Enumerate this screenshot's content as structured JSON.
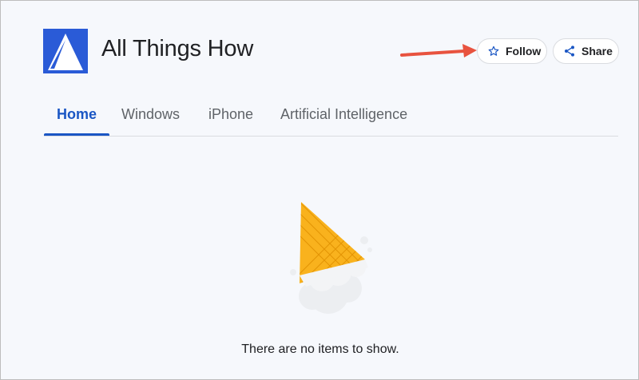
{
  "header": {
    "site_title": "All Things How",
    "follow_label": "Follow",
    "share_label": "Share"
  },
  "tabs": [
    {
      "label": "Home",
      "active": true
    },
    {
      "label": "Windows",
      "active": false
    },
    {
      "label": "iPhone",
      "active": false
    },
    {
      "label": "Artificial Intelligence",
      "active": false
    }
  ],
  "empty_state": {
    "message": "There are no items to show.",
    "illustration": "ice-cream-cone"
  },
  "annotation": {
    "arrow_color": "#e8533f"
  },
  "colors": {
    "accent": "#1a56c4",
    "logo": "#2a5bd7"
  },
  "icons": {
    "follow": "star-icon",
    "share": "share-icon"
  }
}
